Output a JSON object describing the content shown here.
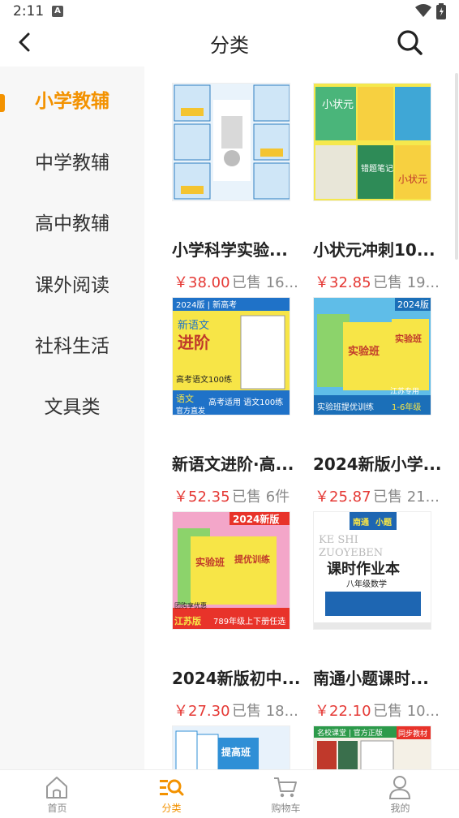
{
  "status_bar": {
    "time": "2:11",
    "notif_badge": "A"
  },
  "header": {
    "title": "分类"
  },
  "categories": [
    {
      "label": "小学教辅",
      "active": true
    },
    {
      "label": "中学教辅"
    },
    {
      "label": "高中教辅"
    },
    {
      "label": "课外阅读"
    },
    {
      "label": "社科生活"
    },
    {
      "label": "文具类"
    }
  ],
  "products": [
    {
      "title": "小学科学实验...",
      "price": "￥38.00",
      "sold": "已售 16...",
      "thumb": {
        "bg": "#e9f3fb",
        "accent": "#2f7fc1",
        "lines": []
      }
    },
    {
      "title": "小状元冲刺10...",
      "price": "￥32.85",
      "sold": "已售 19...",
      "thumb": {
        "bg": "#f5e84d",
        "accent": "#2e8b57",
        "lines": [
          "小状元",
          "错题笔记",
          "小状元"
        ]
      }
    },
    {
      "title": "新语文进阶·高...",
      "price": "￥52.35",
      "sold": "已售 6件",
      "thumb": {
        "bg": "#f7e547",
        "accent": "#1f72c8",
        "lines": [
          "2024版 | 新高考",
          "新语文",
          "进阶",
          "高考语文100练",
          "语文",
          "官方直发",
          "高考适用 语文100练"
        ]
      }
    },
    {
      "title": "2024新版小学...",
      "price": "￥25.87",
      "sold": "已售 21...",
      "thumb": {
        "bg": "#5fbde8",
        "accent": "#1b6fb8",
        "lines": [
          "2024版",
          "实验班",
          "实验班",
          "江苏专用",
          "实验班提优训练",
          "1-6年级"
        ]
      }
    },
    {
      "title": "2024新版初中...",
      "price": "￥27.30",
      "sold": "已售 18...",
      "thumb": {
        "bg": "#f3a6c9",
        "accent": "#e8332a",
        "lines": [
          "2024新版",
          "实验班",
          "提优训练",
          "江苏版",
          "789年级上下册任选",
          "团购享优惠"
        ]
      }
    },
    {
      "title": "南通小题课时...",
      "price": "￥22.10",
      "sold": "已售 10...",
      "thumb": {
        "bg": "#ffffff",
        "accent": "#1e66b2",
        "lines": [
          "南通",
          "小题",
          "KE SHI",
          "ZUOYEBEN",
          "课时作业本",
          "八年级数学"
        ]
      }
    },
    {
      "title": "",
      "price": "",
      "sold": "",
      "thumb": {
        "bg": "#e8f2fb",
        "accent": "#2f8fd6",
        "lines": [
          "提高班"
        ]
      }
    },
    {
      "title": "",
      "price": "",
      "sold": "",
      "thumb": {
        "bg": "#f4f0e6",
        "accent": "#2c9a4a",
        "lines": [
          "名校课堂 | 官方正版",
          "同步教材"
        ]
      }
    }
  ],
  "tabs": [
    {
      "label": "首页",
      "icon": "home-icon"
    },
    {
      "label": "分类",
      "icon": "category-icon",
      "active": true
    },
    {
      "label": "购物车",
      "icon": "cart-icon"
    },
    {
      "label": "我的",
      "icon": "profile-icon"
    }
  ],
  "colors": {
    "accent": "#f39200",
    "price": "#e53935",
    "sidebar_bg": "#f7f7f7"
  }
}
